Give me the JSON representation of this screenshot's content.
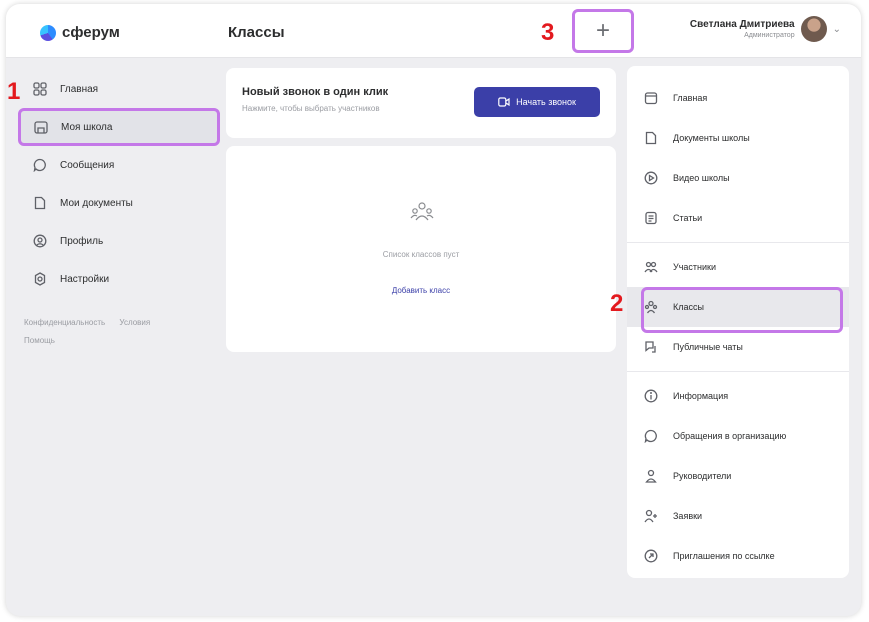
{
  "app": {
    "logo_text": "сферум"
  },
  "header": {
    "title": "Классы",
    "add_icon": "plus-icon",
    "user_name": "Светлана Дмитриева",
    "user_role": "Администратор"
  },
  "sidebar": {
    "items": [
      {
        "label": "Главная",
        "icon": "grid-icon"
      },
      {
        "label": "Моя школа",
        "icon": "school-icon"
      },
      {
        "label": "Сообщения",
        "icon": "chat-icon"
      },
      {
        "label": "Мои документы",
        "icon": "document-icon"
      },
      {
        "label": "Профиль",
        "icon": "profile-icon"
      },
      {
        "label": "Настройки",
        "icon": "gear-icon"
      }
    ],
    "footer": {
      "privacy": "Конфиденциальность",
      "terms": "Условия",
      "help": "Помощь"
    }
  },
  "call_card": {
    "title": "Новый звонок в один клик",
    "subtitle": "Нажмите, чтобы выбрать участников",
    "button_label": "Начать звонок"
  },
  "classes": {
    "empty_text": "Список классов пуст",
    "add_link": "Добавить класс"
  },
  "right_menu": {
    "group1": [
      {
        "label": "Главная",
        "icon": "home-icon"
      },
      {
        "label": "Документы школы",
        "icon": "document-icon"
      },
      {
        "label": "Видео школы",
        "icon": "play-icon"
      },
      {
        "label": "Статьи",
        "icon": "article-icon"
      }
    ],
    "group2": [
      {
        "label": "Участники",
        "icon": "users-icon"
      },
      {
        "label": "Классы",
        "icon": "classes-icon"
      },
      {
        "label": "Публичные чаты",
        "icon": "public-chat-icon"
      }
    ],
    "group3": [
      {
        "label": "Информация",
        "icon": "info-icon"
      },
      {
        "label": "Обращения в организацию",
        "icon": "chat-icon"
      },
      {
        "label": "Руководители",
        "icon": "person-icon"
      },
      {
        "label": "Заявки",
        "icon": "person-add-icon"
      },
      {
        "label": "Приглашения по ссылке",
        "icon": "link-icon"
      }
    ]
  },
  "markers": {
    "m1": "1",
    "m2": "2",
    "m3": "3"
  },
  "colors": {
    "accent": "#3b3fa8",
    "highlight": "#c478e8",
    "marker": "#e3191e"
  }
}
